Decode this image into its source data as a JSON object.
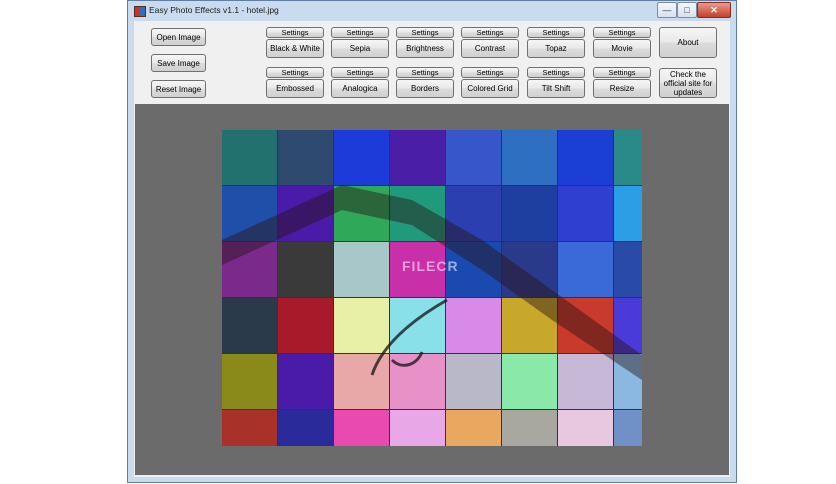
{
  "window": {
    "title": "Easy Photo Effects v1.1 - hotel.jpg",
    "minimize_glyph": "—",
    "maximize_glyph": "□",
    "close_glyph": "✕"
  },
  "left_buttons": {
    "open": "Open Image",
    "save": "Save Image",
    "reset": "Reset Image"
  },
  "settings_label": "Settings",
  "effects_row1": [
    "Black & White",
    "Sepia",
    "Brightness",
    "Contrast",
    "Topaz",
    "Movie"
  ],
  "effects_row2": [
    "Embossed",
    "Analogica",
    "Borders",
    "Colored Grid",
    "Tilt Shift",
    "Resize"
  ],
  "about_label": "About",
  "check_updates_label": "Check the official site for updates",
  "watermark": "FILECR",
  "grid_colors": [
    [
      "#23716f",
      "#2e4a6e",
      "#1d3bd8",
      "#4a1ea6",
      "#3656c9",
      "#2e6fc2",
      "#1b3fd4",
      "#2a8a8a"
    ],
    [
      "#1f4fa8",
      "#4a1aa8",
      "#2fa85a",
      "#1f9a7a",
      "#2b3fb0",
      "#1e3fa0",
      "#2f3fd0",
      "#2b9ee6"
    ],
    [
      "#7a2a8a",
      "#3a3a3a",
      "#a8c8c8",
      "#c82fa8",
      "#1a4ab0",
      "#2a3a8a",
      "#3a6ad8",
      "#2a4aa8"
    ],
    [
      "#2a3a4a",
      "#a81a2a",
      "#e8f0a8",
      "#8ae0e8",
      "#d88ae8",
      "#c8a82a",
      "#c83a2a",
      "#4a3ad8"
    ],
    [
      "#8a8a1a",
      "#4a1aa8",
      "#e8a8a8",
      "#e890c8",
      "#b8b8c8",
      "#8ae8a8",
      "#c8b8d8",
      "#8ab8e0"
    ],
    [
      "#a8322a",
      "#2a2a9a",
      "#e84ab0",
      "#e8a8e8",
      "#e8a860",
      "#a8a8a0",
      "#e8c8e0",
      "#7090c8"
    ]
  ]
}
